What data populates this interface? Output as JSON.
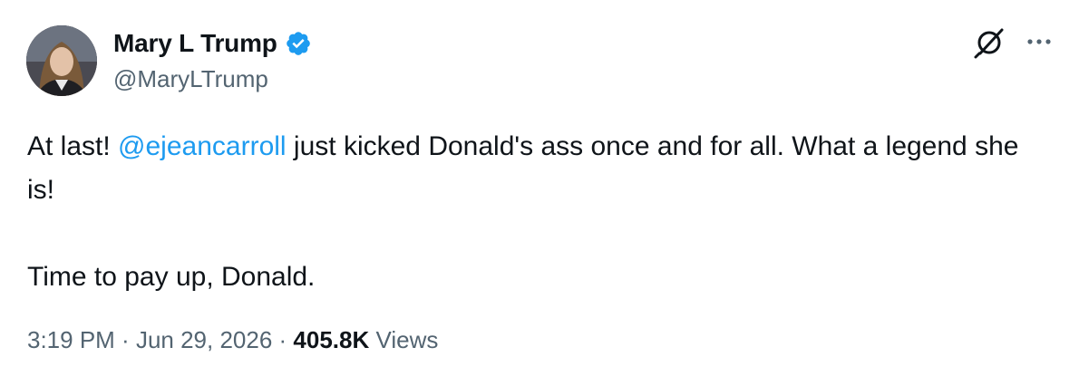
{
  "author": {
    "display_name": "Mary L Trump",
    "handle": "@MaryLTrump",
    "verified_color": "#1d9bf0"
  },
  "tweet": {
    "text_before_mention": "At last! ",
    "mention": "@ejeancarroll",
    "text_after_mention": " just kicked Donald's ass once and for all. What a legend she is!",
    "paragraph_2": "Time to pay up, Donald."
  },
  "meta": {
    "time": "3:19 PM",
    "separator": " · ",
    "date": "Jun 29, 2026",
    "views_count": "405.8K",
    "views_label": " Views"
  },
  "icons": {
    "grok": "grok-icon",
    "more": "more-options-icon",
    "verified": "verified-badge-icon"
  },
  "colors": {
    "link": "#1d9bf0",
    "secondary_text": "#536471",
    "primary_text": "#0f1419"
  }
}
